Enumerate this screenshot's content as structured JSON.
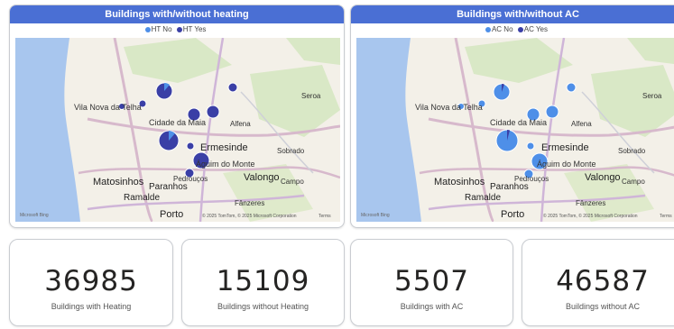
{
  "colors": {
    "header": "#4a6fd4",
    "series_no": "#4e8fe8",
    "series_yes": "#3a3fa6",
    "water": "#a8c6ee",
    "land": "#f3f0e8"
  },
  "panels": [
    {
      "title": "Buildings with/without heating",
      "legend": [
        {
          "label": "HT No",
          "color": "#4e8fe8"
        },
        {
          "label": "HT Yes",
          "color": "#3a3fa6"
        }
      ]
    },
    {
      "title": "Buildings with/without AC",
      "legend": [
        {
          "label": "AC No",
          "color": "#4e8fe8"
        },
        {
          "label": "AC Yes",
          "color": "#3a3fa6"
        }
      ]
    }
  ],
  "map_labels": {
    "vila_nova": "Vila Nova da Telha",
    "cidade_maia": "Cidade da Maia",
    "alfena": "Alfena",
    "seroa": "Seroa",
    "ermesinde": "Ermesinde",
    "sobrado": "Sobrado",
    "aguim": "Águim do Monte",
    "pedroucos": "Pedrouços",
    "valongo": "Valongo",
    "campo": "Campo",
    "matosinhos": "Matosinhos",
    "paranhos": "Paranhos",
    "ramalde": "Ramalde",
    "fanzeres": "Fânzeres",
    "porto": "Porto",
    "attribution": "© 2025 TomTom, © 2025 Microsoft Corporation",
    "terms": "Terms",
    "bing": "Microsoft Bing"
  },
  "kpis": [
    {
      "value": "36985",
      "label": "Buildings with Heating"
    },
    {
      "value": "15109",
      "label": "Buildings without Heating"
    },
    {
      "value": "5507",
      "label": "Buildings with AC"
    },
    {
      "value": "46587",
      "label": "Buildings without AC"
    }
  ]
}
